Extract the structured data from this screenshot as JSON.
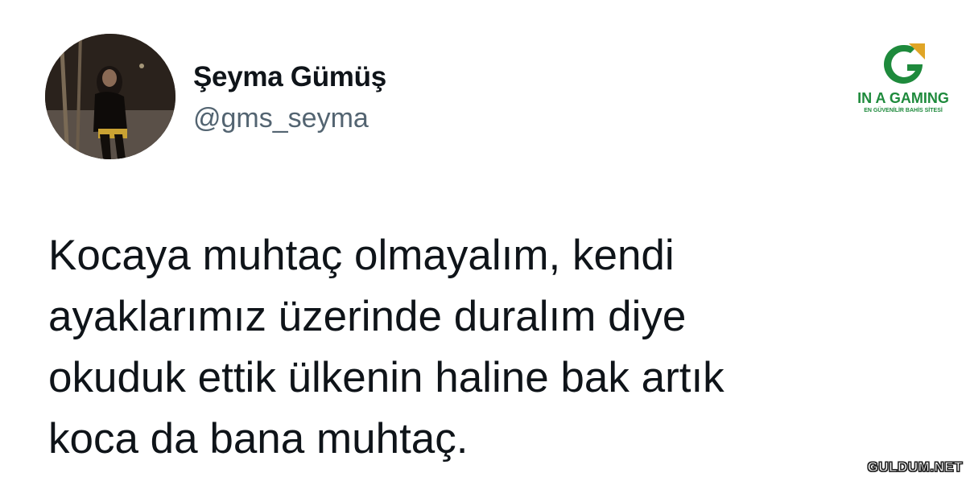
{
  "profile": {
    "display_name": "Şeyma Gümüş",
    "handle": "@gms_seyma",
    "avatar": "profile-photo"
  },
  "tweet": {
    "lines": [
      "Kocaya muhtaç olmayalım, kendi",
      "ayaklarımız üzerinde duralım diye",
      "okuduk ettik ülkenin haline bak artık",
      "koca da bana muhtaç."
    ]
  },
  "logo": {
    "title": "IN A GAMING",
    "subtitle": "EN GÜVENİLİR BAHİS SİTESİ",
    "icon": "g-logo-icon",
    "colors": {
      "green": "#1e8a3c",
      "gold": "#e0a526"
    }
  },
  "watermark": {
    "text": "GULDUM.NET"
  },
  "colors": {
    "text_primary": "#0f1419",
    "text_secondary": "#536471",
    "background": "#ffffff"
  }
}
